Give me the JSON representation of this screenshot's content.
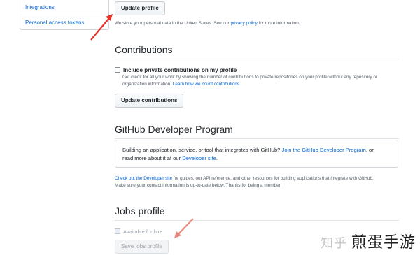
{
  "sidebar": {
    "items": [
      {
        "label": "Integrations"
      },
      {
        "label": "Personal access tokens"
      }
    ]
  },
  "profile": {
    "update_button": "Update profile",
    "privacy_note_prefix": "We store your personal data in the United States. See our ",
    "privacy_link": "privacy policy",
    "privacy_note_suffix": " for more information."
  },
  "contributions": {
    "heading": "Contributions",
    "checkbox_label": "Include private contributions on my profile",
    "desc_line1": "Get credit for all your work by showing the number of contributions to private repositories on your profile without any repository or",
    "desc_line2_prefix": "organization information. ",
    "desc_link": "Learn how we count contributions",
    "desc_line2_suffix": ".",
    "update_button": "Update contributions"
  },
  "developer_program": {
    "heading": "GitHub Developer Program",
    "box_text1": "Building an application, service, or tool that integrates with GitHub? ",
    "box_link1": "Join the GitHub Developer Program",
    "box_text2": ", or",
    "box_text3": "read more about it at our ",
    "box_link2": "Developer site",
    "box_text4": ".",
    "para_link": "Check out the Developer site",
    "para_line1_rest": " for guides, our API reference, and other resources for building applications that integrate with GitHub.",
    "para_line2": "Make sure your contact information is up-to-date below. Thanks for being a member!"
  },
  "jobs": {
    "heading": "Jobs profile",
    "available_label": "Available for hire",
    "save_button": "Save jobs profile"
  },
  "watermark": {
    "faint": "知乎",
    "text": "煎蛋手游"
  },
  "colors": {
    "link": "#0366d6",
    "annotation_arrow": "#e0332c"
  }
}
